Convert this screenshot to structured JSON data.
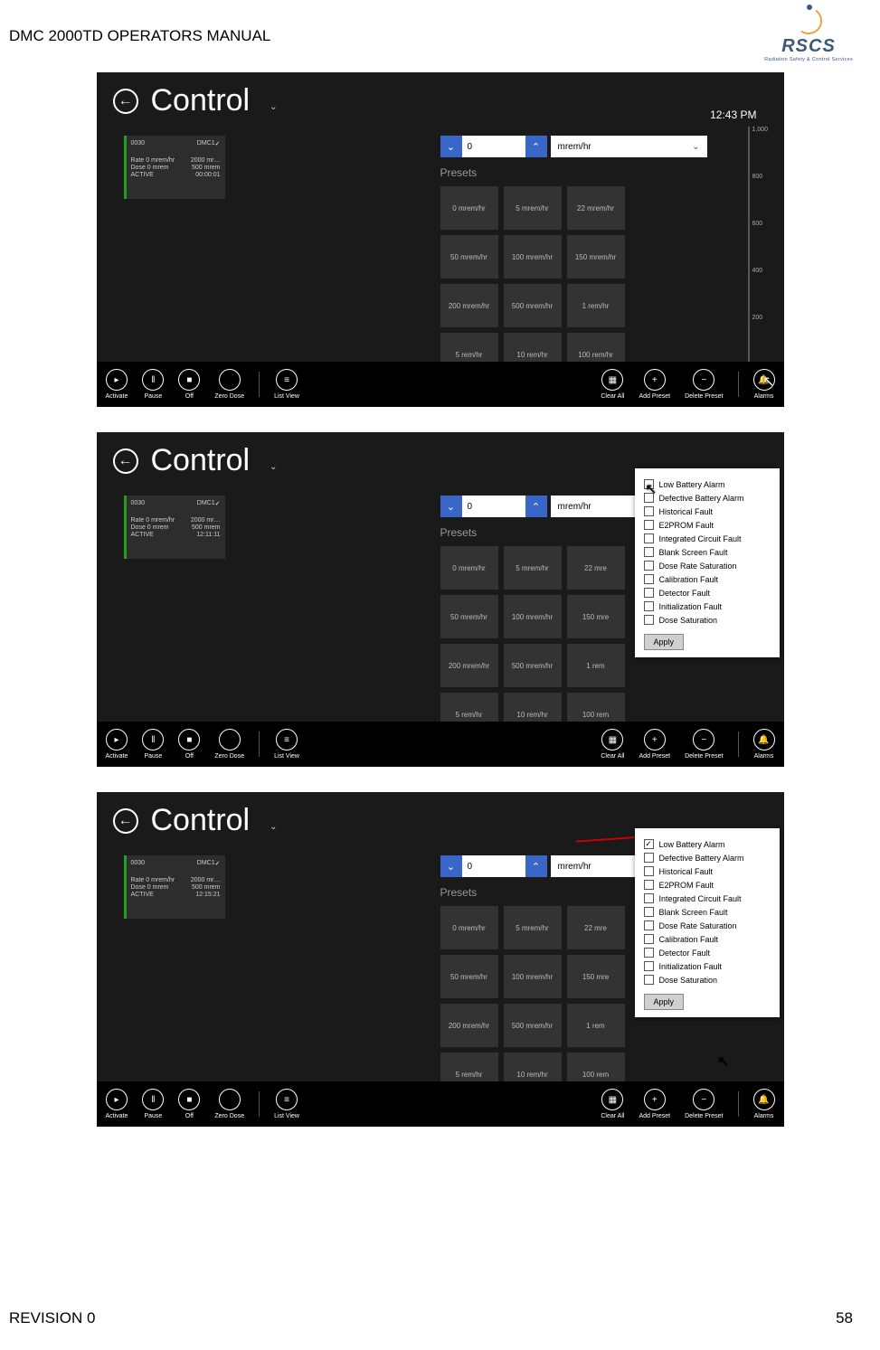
{
  "doc": {
    "title": "DMC 2000TD OPERATORS MANUAL",
    "revision": "REVISION 0",
    "page": "58"
  },
  "logo": {
    "main": "RSCS",
    "sub": "Radiation Safety & Control Services"
  },
  "screen": {
    "title": "Control",
    "time": "12:43 PM",
    "device": {
      "id": "0030",
      "model": "DMC1",
      "rate_l": "Rate 0 mrem/hr",
      "rate_r": "2000 mr…",
      "dose_l": "Dose 0 mrem",
      "dose_r": "500 mrem",
      "status_l": "ACTIVE",
      "status_r": "00:00:01",
      "status_r2": "12:11:11",
      "status_r3": "12:15:21"
    },
    "spinner": {
      "down": "⌄",
      "up": "⌃",
      "value": "0",
      "unit": "mrem/hr"
    },
    "presets_label": "Presets",
    "presets": [
      "0 mrem/hr",
      "5 mrem/hr",
      "22 mrem/hr",
      "50 mrem/hr",
      "100 mrem/hr",
      "150 mrem/hr",
      "200 mrem/hr",
      "500 mrem/hr",
      "1 rem/hr",
      "5 rem/hr",
      "10 rem/hr",
      "100 rem/hr"
    ],
    "scale": [
      "1,000",
      "800",
      "600",
      "400",
      "200"
    ]
  },
  "cmd": {
    "activate": "Activate",
    "pause": "Pause",
    "off": "Off",
    "zero": "Zero Dose",
    "list": "List View",
    "clear": "Clear All",
    "addp": "Add Preset",
    "delp": "Delete Preset",
    "alarms": "Alarms"
  },
  "popup": {
    "opts": [
      "Low Battery Alarm",
      "Defective Battery Alarm",
      "Historical Fault",
      "E2PROM Fault",
      "Integrated Circuit Fault",
      "Blank Screen Fault",
      "Dose Rate Saturation",
      "Calibration Fault",
      "Detector Fault",
      "Initialization Fault",
      "Dose Saturation"
    ],
    "apply": "Apply"
  }
}
